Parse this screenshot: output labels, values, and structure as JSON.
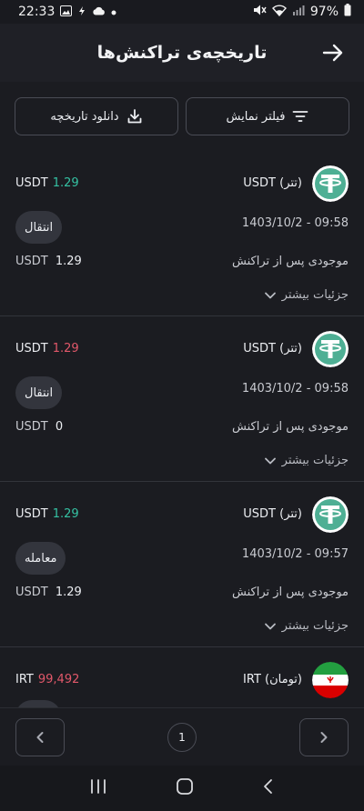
{
  "status": {
    "time": "22:33",
    "battery": "97%"
  },
  "header": {
    "title": "تاریخچه‌ی تراکنش‌ها"
  },
  "toolbar": {
    "filter_label": "فیلتر نمایش",
    "download_label": "دانلود تاریخچه"
  },
  "common": {
    "balance_label": "موجودی پس از تراکنش",
    "details_label": "جزئیات بیشتر"
  },
  "transactions": [
    {
      "asset": "USDT (تتر)",
      "currency": "USDT",
      "amount": "1.29",
      "amount_sign": "positive",
      "type": "انتقال",
      "datetime": "1403/10/2 - 09:58",
      "balance_currency": "USDT",
      "balance": "1.29"
    },
    {
      "asset": "USDT (تتر)",
      "currency": "USDT",
      "amount": "1.29",
      "amount_sign": "negative",
      "type": "انتقال",
      "datetime": "1403/10/2 - 09:58",
      "balance_currency": "USDT",
      "balance": "0"
    },
    {
      "asset": "USDT (تتر)",
      "currency": "USDT",
      "amount": "1.29",
      "amount_sign": "positive",
      "type": "معامله",
      "datetime": "1403/10/2 - 09:57",
      "balance_currency": "USDT",
      "balance": "1.29"
    },
    {
      "asset": "IRT (تومان)",
      "currency": "IRT",
      "amount": "99,492",
      "amount_sign": "negative",
      "type": "",
      "datetime": "",
      "balance_currency": "",
      "balance": ""
    }
  ],
  "pagination": {
    "current_page": "1"
  },
  "colors": {
    "background": "#1b1c21",
    "positive": "#35c2a3",
    "negative": "#e2586a",
    "tether": "#4eaf94"
  }
}
